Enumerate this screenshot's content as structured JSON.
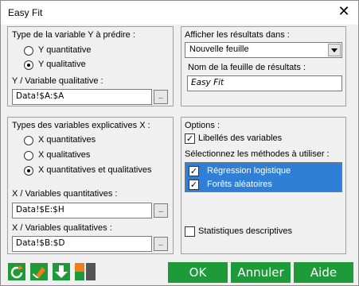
{
  "window": {
    "title": "Easy Fit"
  },
  "y_panel": {
    "heading": "Type de la variable Y à prédire :",
    "options": [
      "Y quantitative",
      "Y qualitative"
    ],
    "selected": 1,
    "field_label": "Y / Variable qualitative :",
    "field_value": "Data!$A:$A",
    "range_button": "_"
  },
  "x_panel": {
    "heading": "Types des variables explicatives X :",
    "options": [
      "X quantitatives",
      "X qualitatives",
      "X quantitatives et qualitatives"
    ],
    "selected": 2,
    "quant_label": "X / Variables quantitatives :",
    "quant_value": "Data!$E:$H",
    "qual_label": "X / Variables qualitatives :",
    "qual_value": "Data!$B:$D",
    "range_button": "_"
  },
  "output_panel": {
    "heading": "Afficher les résultats dans :",
    "select_value": "Nouvelle feuille",
    "sheet_label": "Nom de la feuille de résultats :",
    "sheet_value": "Easy Fit"
  },
  "options_panel": {
    "heading": "Options :",
    "libelles": {
      "label": "Libellés des variables",
      "checked": true
    },
    "methods_label": "Sélectionnez les méthodes à utiliser :",
    "methods": [
      {
        "label": "Régression logistique",
        "checked": true
      },
      {
        "label": "Forêts aléatoires",
        "checked": true
      }
    ],
    "stats": {
      "label": "Statistiques descriptives",
      "checked": false
    }
  },
  "footer": {
    "ok": "OK",
    "cancel": "Annuler",
    "help": "Aide",
    "icons": [
      "reset-icon",
      "eraser-icon",
      "download-icon",
      "layout-icon"
    ]
  },
  "colors": {
    "accent_green": "#1f9a3a",
    "selection_blue": "#2f7fd6",
    "orange": "#f07d1a"
  }
}
